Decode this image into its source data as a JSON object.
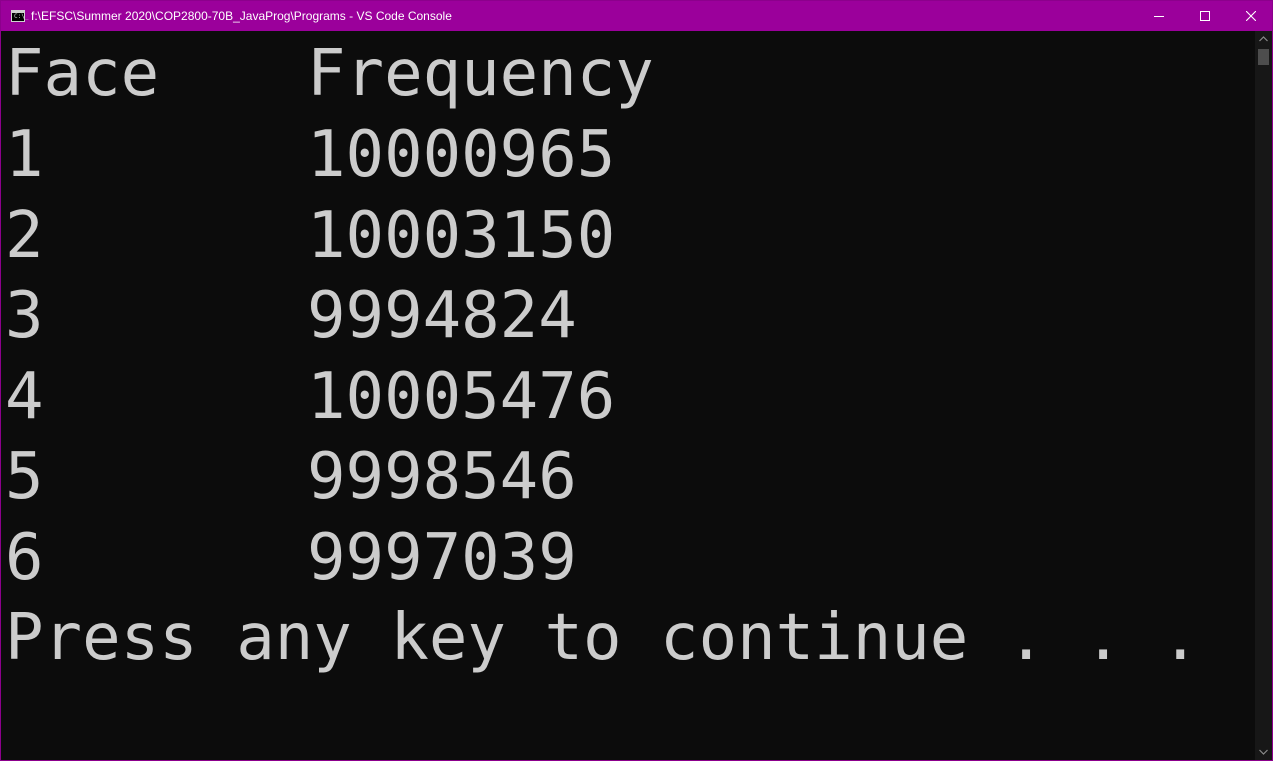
{
  "window": {
    "title": "f:\\EFSC\\Summer 2020\\COP2800-70B_JavaProg\\Programs - VS Code Console",
    "app_icon_text": "C:\\_",
    "controls": [
      "minimize-icon",
      "maximize-icon",
      "close-icon"
    ],
    "titlebar_color": "#9b009b"
  },
  "console": {
    "background": "#0c0c0c",
    "foreground": "#cccccc",
    "header": {
      "face": "Face",
      "frequency": "Frequency"
    },
    "rows": [
      {
        "face": "1",
        "frequency": "10000965"
      },
      {
        "face": "2",
        "frequency": "10003150"
      },
      {
        "face": "3",
        "frequency": "9994824"
      },
      {
        "face": "4",
        "frequency": "10005476"
      },
      {
        "face": "5",
        "frequency": "9998546"
      },
      {
        "face": "6",
        "frequency": "9997039"
      }
    ],
    "prompt": "Press any key to continue . . ."
  }
}
